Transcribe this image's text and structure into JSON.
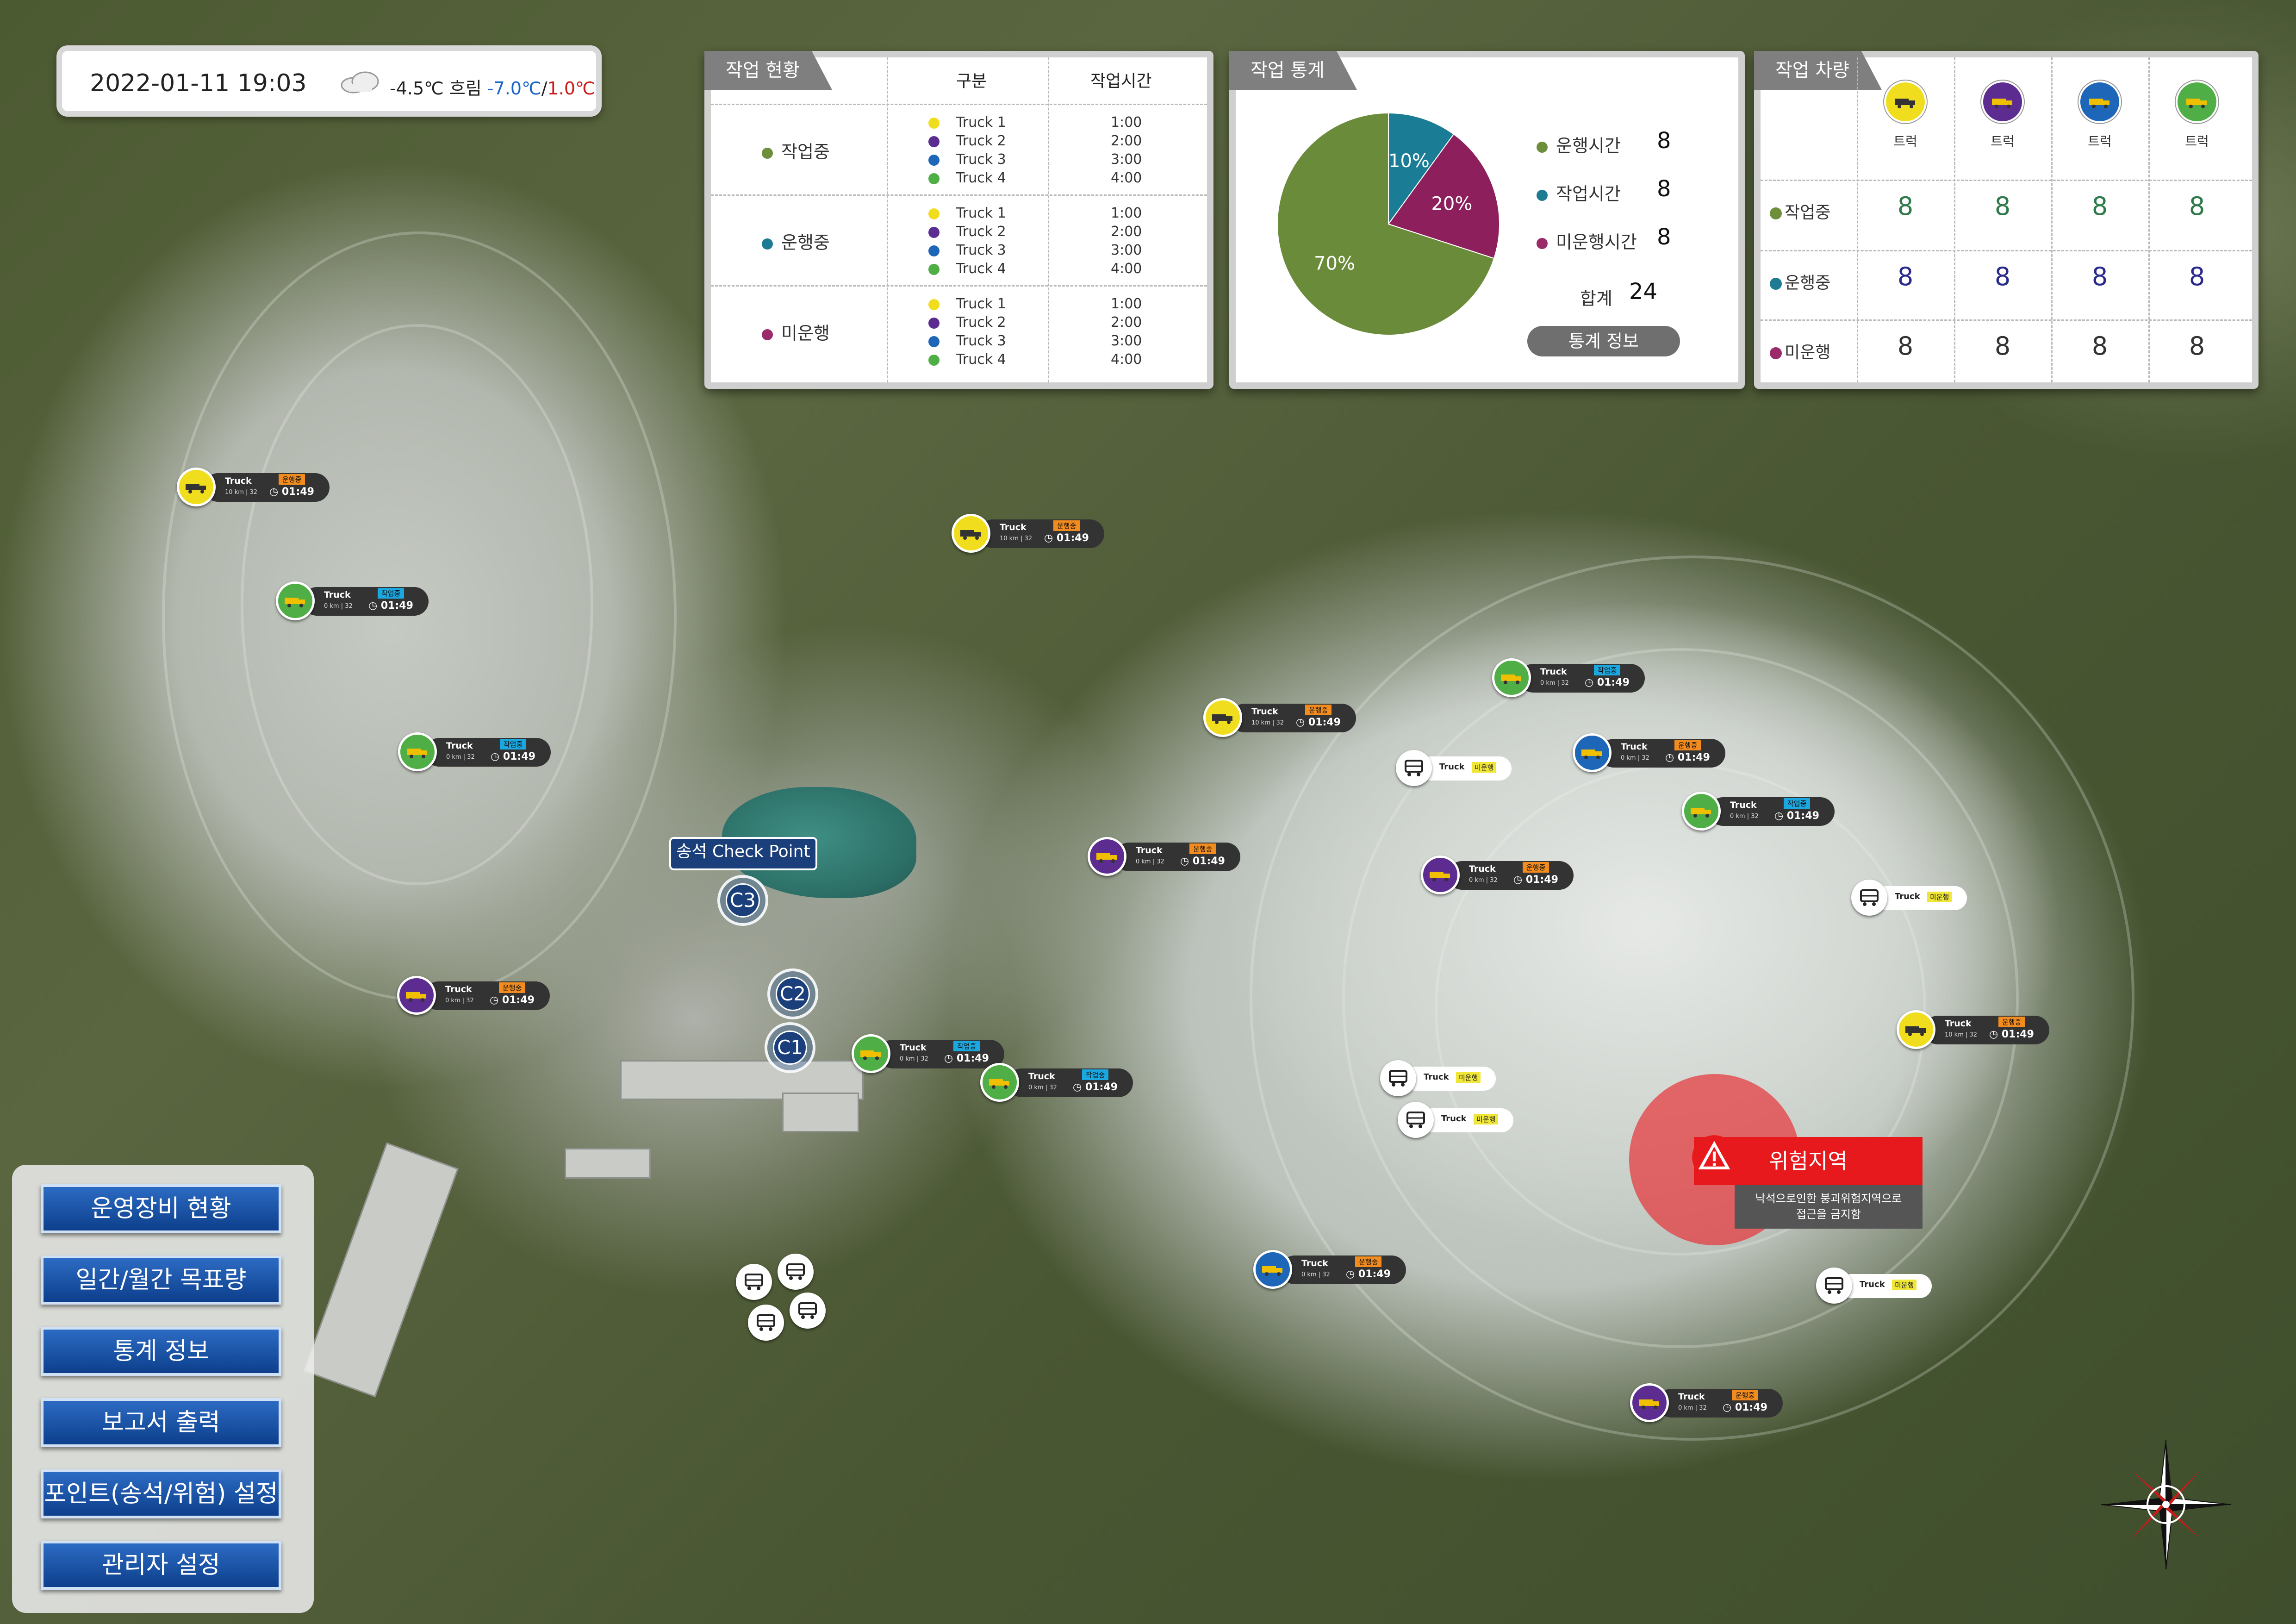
{
  "header": {
    "datetime": "2022-01-11 19:03",
    "weather_icon": "cloud-icon",
    "temperature": "-4.5℃ 흐림",
    "temp_low": "-7.0℃",
    "temp_sep": "/",
    "temp_high": "1.0℃",
    "temp_low_color": "#1a63c8",
    "temp_high_color": "#cc1b1b"
  },
  "work_status": {
    "title": "작업 현황",
    "col_category": "구분",
    "col_time": "작업시간",
    "groups": [
      {
        "label": "작업중",
        "color": "#6d8f3b",
        "trucks": [
          "Truck 1",
          "Truck 2",
          "Truck 3",
          "Truck 4"
        ],
        "times": [
          "1:00",
          "2:00",
          "3:00",
          "4:00"
        ]
      },
      {
        "label": "운행중",
        "color": "#1f7b93",
        "trucks": [
          "Truck 1",
          "Truck 2",
          "Truck 3",
          "Truck 4"
        ],
        "times": [
          "1:00",
          "2:00",
          "3:00",
          "4:00"
        ]
      },
      {
        "label": "미운행",
        "color": "#9a2a6a",
        "trucks": [
          "Truck 1",
          "Truck 2",
          "Truck 3",
          "Truck 4"
        ],
        "times": [
          "1:00",
          "2:00",
          "3:00",
          "4:00"
        ]
      }
    ]
  },
  "work_stats": {
    "title": "작업 통계",
    "legend": [
      {
        "label": "운행시간",
        "value": "8",
        "color": "#6d8f3b"
      },
      {
        "label": "작업시간",
        "value": "8",
        "color": "#1f7b93"
      },
      {
        "label": "미운행시간",
        "value": "8",
        "color": "#9a2a6a"
      }
    ],
    "total_label": "합계",
    "total_value": "24",
    "button": "통계 정보"
  },
  "chart_data": {
    "type": "pie",
    "slices": [
      {
        "label": "10%",
        "value": 10,
        "color": "#1a7d95"
      },
      {
        "label": "20%",
        "value": 20,
        "color": "#8c1f5c"
      },
      {
        "label": "70%",
        "value": 70,
        "color": "#6a8c3a"
      }
    ]
  },
  "work_vehicles": {
    "title": "작업 차량",
    "columns": [
      {
        "label": "트럭",
        "icon": "yellow-truck-icon",
        "color": "#f0de1e"
      },
      {
        "label": "트럭",
        "icon": "purple-truck-icon",
        "color": "#5c2c91"
      },
      {
        "label": "트럭",
        "icon": "blue-truck-icon",
        "color": "#1e66b8"
      },
      {
        "label": "트럭",
        "icon": "green-truck-icon",
        "color": "#4fae45"
      }
    ],
    "rows": [
      {
        "label": "작업중",
        "color": "#6d8f3b",
        "text_color": "#2f7a4a",
        "values": [
          "8",
          "8",
          "8",
          "8"
        ]
      },
      {
        "label": "운행중",
        "color": "#1f7b93",
        "text_color": "#2a2a8c",
        "values": [
          "8",
          "8",
          "8",
          "8"
        ]
      },
      {
        "label": "미운행",
        "color": "#9a2a6a",
        "text_color": "#333333",
        "values": [
          "8",
          "8",
          "8",
          "8"
        ]
      }
    ]
  },
  "menu": [
    "운영장비 현황",
    "일간/월간 목표량",
    "통계 정보",
    "보고서 출력",
    "포인트(송석/위험) 설정",
    "관리자 설정"
  ],
  "checkpoint": {
    "label": "송석 Check Point",
    "c1": "C1",
    "c2": "C2",
    "c3": "C3"
  },
  "danger": {
    "title": "위험지역",
    "message_line1": "낙석으로인한 붕괴위험지역으로",
    "message_line2": "접근을 금지함"
  },
  "trucks": [
    {
      "name": "Truck",
      "status": "운행중",
      "km": "10 km | 32",
      "time": "01:49",
      "color": "yellow"
    },
    {
      "name": "Truck",
      "status": "작업중",
      "km": "0 km | 32",
      "time": "01:49",
      "color": "green"
    },
    {
      "name": "Truck",
      "status": "작업중",
      "km": "0 km | 32",
      "time": "01:49",
      "color": "green"
    },
    {
      "name": "Truck",
      "status": "운행중",
      "km": "0 km | 32",
      "time": "01:49",
      "color": "purple"
    },
    {
      "name": "Truck",
      "status": "운행중",
      "km": "10 km | 32",
      "time": "01:49",
      "color": "yellow"
    },
    {
      "name": "Truck",
      "status": "운행중",
      "km": "0 km | 32",
      "time": "01:49",
      "color": "purple"
    },
    {
      "name": "Truck",
      "status": "작업중",
      "km": "0 km | 32",
      "time": "01:49",
      "color": "green"
    },
    {
      "name": "Truck",
      "status": "작업중",
      "km": "0 km | 32",
      "time": "01:49",
      "color": "green"
    },
    {
      "name": "Truck",
      "status": "운행중",
      "km": "10 km | 32",
      "time": "01:49",
      "color": "yellow"
    },
    {
      "name": "Truck",
      "status": "작업중",
      "km": "0 km | 32",
      "time": "01:49",
      "color": "green"
    },
    {
      "name": "Truck",
      "status": "운행중",
      "km": "0 km | 32",
      "time": "01:49",
      "color": "blue"
    },
    {
      "name": "Truck",
      "status": "작업중",
      "km": "0 km | 32",
      "time": "01:49",
      "color": "green"
    },
    {
      "name": "Truck",
      "status": "운행중",
      "km": "0 km | 32",
      "time": "01:49",
      "color": "purple"
    },
    {
      "name": "Truck",
      "status": "운행중",
      "km": "10 km | 32",
      "time": "01:49",
      "color": "yellow"
    },
    {
      "name": "Truck",
      "status": "운행중",
      "km": "0 km | 32",
      "time": "01:49",
      "color": "blue"
    },
    {
      "name": "Truck",
      "status": "운행중",
      "km": "0 km | 32",
      "time": "01:49",
      "color": "purple"
    }
  ],
  "idle_trucks": [
    {
      "name": "Truck",
      "status": "미운행"
    },
    {
      "name": "Truck",
      "status": "미운행"
    },
    {
      "name": "Truck",
      "status": "미운행"
    },
    {
      "name": "Truck",
      "status": "미운행"
    },
    {
      "name": "Truck",
      "status": "미운행"
    }
  ],
  "compass_icon": "compass-rose-icon"
}
